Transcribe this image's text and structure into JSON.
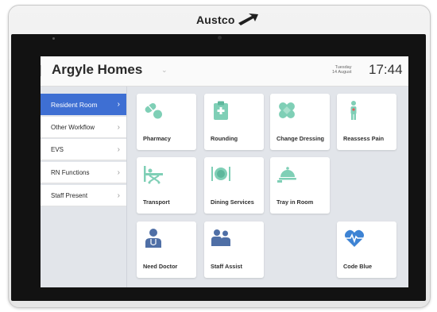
{
  "device": {
    "brand": "Austco"
  },
  "header": {
    "title": "Argyle Homes",
    "day": "Tuesday",
    "date": "14 August",
    "time": "17:44"
  },
  "sidebar": {
    "items": [
      {
        "label": "Resident Room",
        "active": true
      },
      {
        "label": "Other Workflow",
        "active": false
      },
      {
        "label": "EVS",
        "active": false
      },
      {
        "label": "RN Functions",
        "active": false
      },
      {
        "label": "Staff Present",
        "active": false
      }
    ]
  },
  "tiles": [
    {
      "label": "Pharmacy",
      "icon": "pills-icon",
      "color": "#7fcfb6"
    },
    {
      "label": "Rounding",
      "icon": "clipboard-icon",
      "color": "#7fcfb6"
    },
    {
      "label": "Change Dressing",
      "icon": "bandage-icon",
      "color": "#7fcfb6"
    },
    {
      "label": "Reassess Pain",
      "icon": "person-pain-icon",
      "color": "#7fcfb6"
    },
    {
      "label": "Transport",
      "icon": "stretcher-icon",
      "color": "#7fcfb6"
    },
    {
      "label": "Dining Services",
      "icon": "plate-cutlery-icon",
      "color": "#7fcfb6"
    },
    {
      "label": "Tray in Room",
      "icon": "cloche-icon",
      "color": "#7fcfb6"
    },
    {
      "label": "Need Doctor",
      "icon": "doctor-icon",
      "color": "#4f6fa6"
    },
    {
      "label": "Staff Assist",
      "icon": "staff-icon",
      "color": "#4f6fa6"
    },
    {
      "label": "Code Blue",
      "icon": "heartbeat-icon",
      "color": "#3d83d4"
    }
  ],
  "colors": {
    "accent": "#3e6fd3",
    "icon_green": "#7fcfb6",
    "icon_navy": "#4f6fa6",
    "icon_blue": "#3d83d4"
  }
}
